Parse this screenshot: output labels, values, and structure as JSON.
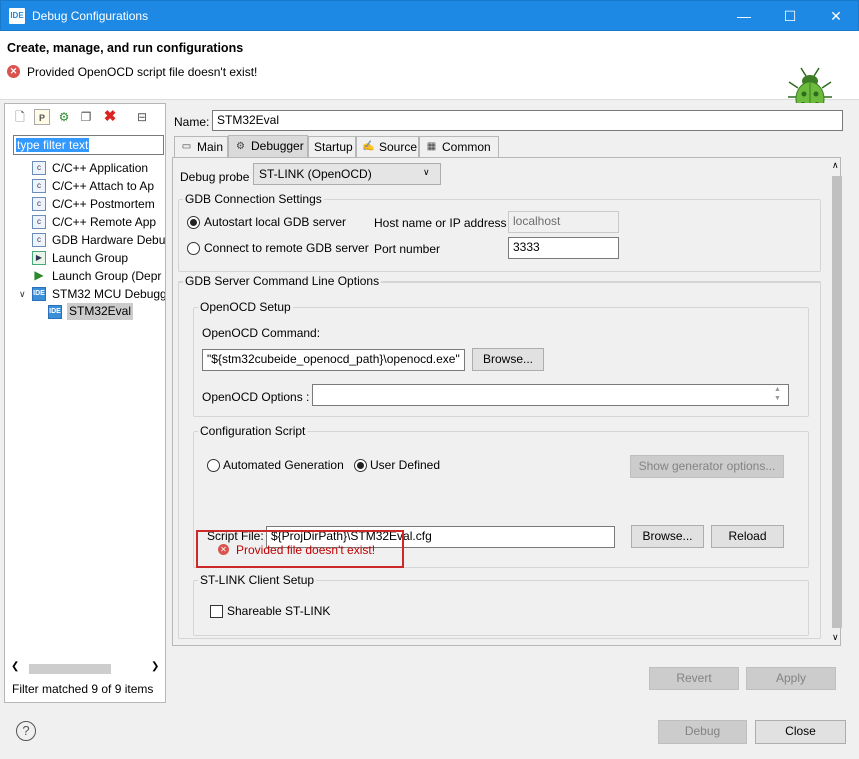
{
  "window": {
    "title": "Debug Configurations",
    "app_icon_text": "IDE",
    "minimize_icon": "minimize-icon",
    "maximize_icon": "maximize-icon",
    "close_icon": "close-icon"
  },
  "header": {
    "title": "Create, manage, and run configurations",
    "message": "Provided OpenOCD script file doesn't exist!",
    "error_icon": "error-icon",
    "logo_icon": "bug-icon"
  },
  "left": {
    "toolbar_icons": [
      "new-config-icon",
      "new-prototype-icon",
      "export-icon",
      "duplicate-icon",
      "delete-icon",
      "collapse-all-icon"
    ],
    "filter_placeholder": "type filter text",
    "tree": [
      {
        "label": "C/C++ Application",
        "icon": "c-icon"
      },
      {
        "label": "C/C++ Attach to Ap",
        "icon": "c-icon"
      },
      {
        "label": "C/C++ Postmortem",
        "icon": "c-icon"
      },
      {
        "label": "C/C++ Remote App",
        "icon": "c-icon"
      },
      {
        "label": "GDB Hardware Debu",
        "icon": "c-icon"
      },
      {
        "label": "Launch Group",
        "icon": "launch-group-icon"
      },
      {
        "label": "Launch Group (Depr",
        "icon": "launch-icon"
      },
      {
        "label": "STM32 MCU Debugg",
        "icon": "ide-icon",
        "expanded": true
      },
      {
        "label": "STM32Eval",
        "icon": "ide-icon",
        "selected": true
      }
    ],
    "filter_status": "Filter matched 9 of 9 items"
  },
  "right": {
    "name_label": "Name:",
    "name_value": "STM32Eval",
    "tabs": [
      {
        "label": "Main",
        "icon": "main-tab-icon"
      },
      {
        "label": "Debugger",
        "icon": "debugger-tab-icon",
        "active": true
      },
      {
        "label": "Startup",
        "icon": ""
      },
      {
        "label": "Source",
        "icon": "source-tab-icon"
      },
      {
        "label": "Common",
        "icon": "common-tab-icon"
      }
    ],
    "debug_probe_label": "Debug probe",
    "debug_probe_value": "ST-LINK (OpenOCD)",
    "gdb_conn": {
      "title": "GDB Connection Settings",
      "autostart_label": "Autostart local GDB server",
      "remote_label": "Connect to remote GDB server",
      "host_label": "Host name or IP address",
      "host_value": "localhost",
      "port_label": "Port number",
      "port_value": "3333"
    },
    "gdb_server": {
      "title": "GDB Server Command Line Options",
      "openocd_setup_title": "OpenOCD Setup",
      "openocd_command_label": "OpenOCD Command:",
      "openocd_command_value": "\"${stm32cubeide_openocd_path}\\openocd.exe\"",
      "browse_label": "Browse...",
      "openocd_options_label": "OpenOCD Options :",
      "openocd_options_value": ""
    },
    "config_script": {
      "title": "Configuration Script",
      "automated_label": "Automated Generation",
      "user_defined_label": "User Defined",
      "show_generator_label": "Show generator options...",
      "error_text": "Provided file doesn't exist!",
      "script_file_label": "Script File:",
      "script_file_value": "${ProjDirPath}\\STM32Eval.cfg",
      "browse_label": "Browse...",
      "reload_label": "Reload"
    },
    "stlink_client": {
      "title": "ST-LINK Client Setup",
      "shareable_label": "Shareable ST-LINK"
    },
    "revert_label": "Revert",
    "apply_label": "Apply"
  },
  "footer": {
    "help_icon": "help-icon",
    "debug_label": "Debug",
    "close_label": "Close"
  }
}
